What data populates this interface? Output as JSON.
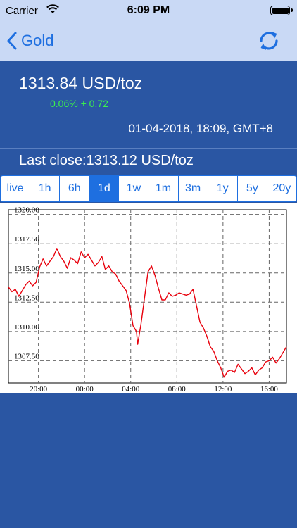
{
  "status_bar": {
    "carrier": "Carrier",
    "time": "6:09 PM"
  },
  "nav": {
    "back_label": "Gold"
  },
  "quote": {
    "price": "1313.84 USD/toz",
    "change": "0.06% + 0.72",
    "timestamp": "01-04-2018, 18:09, GMT+8",
    "last_close": "Last close:1313.12 USD/toz"
  },
  "ranges": {
    "items": [
      "live",
      "1h",
      "6h",
      "1d",
      "1w",
      "1m",
      "3m",
      "1y",
      "5y",
      "20y"
    ],
    "selected": "1d"
  },
  "colors": {
    "accent": "#1e6fe0",
    "background": "#2a56a3",
    "nav": "#c9d9f5",
    "change": "#3bef4e",
    "line": "#e8000c"
  },
  "chart_data": {
    "type": "line",
    "x_tick_labels": [
      "20:00",
      "00:00",
      "04:00",
      "08:00",
      "12:00",
      "16:00"
    ],
    "y_tick_labels": [
      "1320.00",
      "1317.50",
      "1315.00",
      "1312.50",
      "1310.00",
      "1307.50"
    ],
    "ylim": [
      1305.6,
      1320.4
    ],
    "xlim": [
      17.4,
      41.5
    ],
    "grid": true,
    "series": [
      {
        "x": [
          17.4,
          17.7,
          18.0,
          18.3,
          18.6,
          18.9,
          19.2,
          19.5,
          19.8,
          20.1,
          20.4,
          20.7,
          21.0,
          21.3,
          21.6,
          21.9,
          22.2,
          22.5,
          22.8,
          23.1,
          23.4,
          23.7,
          24.0,
          24.3,
          24.6,
          24.9,
          25.2,
          25.5,
          25.8,
          26.1,
          26.4,
          26.7,
          27.0,
          27.3,
          27.6,
          27.9,
          28.2,
          28.5,
          28.6,
          28.9,
          29.2,
          29.5,
          29.8,
          30.1,
          30.4,
          30.7,
          31.0,
          31.3,
          31.6,
          31.9,
          32.2,
          32.5,
          32.8,
          33.1,
          33.4,
          33.7,
          34.0,
          34.3,
          34.6,
          34.9,
          35.2,
          35.5,
          35.8,
          36.1,
          36.4,
          36.7,
          37.0,
          37.3,
          37.6,
          37.9,
          38.2,
          38.5,
          38.8,
          39.1,
          39.4,
          39.7,
          40.0,
          40.3,
          40.6,
          40.9,
          41.2,
          41.5
        ],
        "y": [
          1313.8,
          1313.4,
          1313.6,
          1313.0,
          1313.5,
          1314.0,
          1314.3,
          1313.9,
          1314.2,
          1315.5,
          1316.2,
          1315.6,
          1316.0,
          1316.4,
          1317.1,
          1316.4,
          1316.0,
          1315.4,
          1316.3,
          1316.1,
          1315.8,
          1316.8,
          1316.3,
          1316.6,
          1316.1,
          1315.6,
          1315.9,
          1316.4,
          1315.3,
          1315.6,
          1315.1,
          1314.9,
          1314.3,
          1313.9,
          1313.5,
          1312.4,
          1310.5,
          1310.0,
          1308.9,
          1310.7,
          1312.9,
          1315.1,
          1315.6,
          1314.8,
          1313.7,
          1312.7,
          1312.7,
          1313.3,
          1313.0,
          1313.1,
          1313.3,
          1313.2,
          1313.1,
          1313.2,
          1313.6,
          1312.2,
          1310.8,
          1310.3,
          1309.6,
          1308.7,
          1308.3,
          1307.5,
          1306.9,
          1306.1,
          1306.6,
          1306.7,
          1306.5,
          1307.2,
          1306.8,
          1306.4,
          1306.6,
          1306.9,
          1306.3,
          1306.7,
          1306.9,
          1307.4,
          1307.5,
          1307.8,
          1307.3,
          1307.7,
          1308.2,
          1308.7
        ]
      }
    ]
  }
}
